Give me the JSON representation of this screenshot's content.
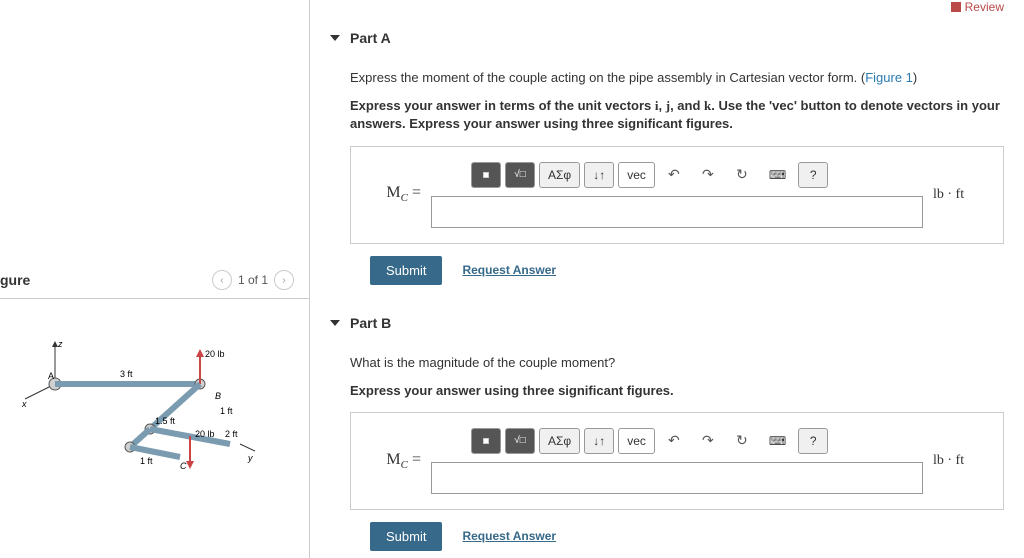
{
  "review": {
    "label": "Review"
  },
  "figure": {
    "title": "gure",
    "nav": "1 of 1",
    "labels": {
      "force1": "20 lb",
      "force2": "20 lb",
      "dim1": "3 ft",
      "dim2": "1.5 ft",
      "dim3": "1 ft",
      "dim4": "2 ft",
      "dim5": "1 ft",
      "axis_x": "x",
      "axis_y": "y",
      "axis_z": "z",
      "pt_a": "A",
      "pt_b": "B",
      "pt_c": "C"
    }
  },
  "partA": {
    "title": "Part A",
    "prompt1_pre": "Express the moment of the couple acting on the pipe assembly in Cartesian vector form. (",
    "prompt1_link": "Figure 1",
    "prompt1_post": ")",
    "prompt2": "Express your answer in terms of the unit vectors i, j, and k. Use the 'vec' button to denote vectors in your answers. Express your answer using three significant figures.",
    "var_label": "M",
    "var_sub": "C",
    "eq": " = ",
    "units": "lb · ft",
    "submit": "Submit",
    "request": "Request Answer",
    "toolbar": {
      "greek": "ΑΣφ",
      "vec": "vec",
      "updown": "↓↑",
      "undo": "↶",
      "redo": "↷",
      "reset": "↻",
      "keyboard": "⌨",
      "help": "?"
    }
  },
  "partB": {
    "title": "Part B",
    "prompt1": "What is the magnitude of the couple moment?",
    "prompt2": "Express your answer using three significant figures.",
    "var_label": "M",
    "var_sub": "C",
    "eq": " = ",
    "units": "lb · ft",
    "submit": "Submit",
    "request": "Request Answer",
    "toolbar": {
      "greek": "ΑΣφ",
      "vec": "vec",
      "updown": "↓↑",
      "undo": "↶",
      "redo": "↷",
      "reset": "↻",
      "keyboard": "⌨",
      "help": "?"
    }
  }
}
